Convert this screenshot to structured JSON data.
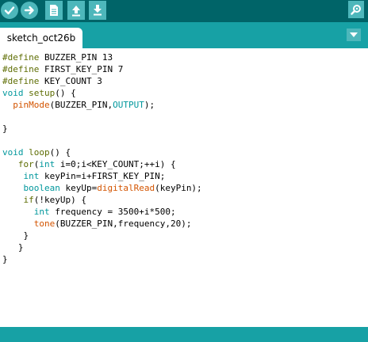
{
  "toolbar": {
    "buttons": [
      "verify-icon",
      "upload-icon",
      "new-icon",
      "open-icon",
      "save-icon"
    ],
    "serial_monitor": "serial-monitor-icon"
  },
  "tabs": [
    {
      "label": "sketch_oct26b",
      "active": true
    }
  ],
  "editor": {
    "lines": [
      [
        {
          "t": "#define",
          "c": "kw-pp"
        },
        {
          "t": " BUZZER_PIN 13"
        }
      ],
      [
        {
          "t": "#define",
          "c": "kw-pp"
        },
        {
          "t": " FIRST_KEY_PIN 7"
        }
      ],
      [
        {
          "t": "#define",
          "c": "kw-pp"
        },
        {
          "t": " KEY_COUNT 3"
        }
      ],
      [
        {
          "t": "void",
          "c": "kw-type"
        },
        {
          "t": " "
        },
        {
          "t": "setup",
          "c": "kw-ctrl"
        },
        {
          "t": "() {"
        }
      ],
      [
        {
          "t": "  "
        },
        {
          "t": "pinMode",
          "c": "kw-fn"
        },
        {
          "t": "(BUZZER_PIN,"
        },
        {
          "t": "OUTPUT",
          "c": "kw-type"
        },
        {
          "t": ");"
        }
      ],
      [],
      [
        {
          "t": "}"
        }
      ],
      [],
      [
        {
          "t": "void",
          "c": "kw-type"
        },
        {
          "t": " "
        },
        {
          "t": "loop",
          "c": "kw-ctrl"
        },
        {
          "t": "() {"
        }
      ],
      [
        {
          "t": "   "
        },
        {
          "t": "for",
          "c": "kw-ctrl"
        },
        {
          "t": "("
        },
        {
          "t": "int",
          "c": "kw-type"
        },
        {
          "t": " i=0;i<KEY_COUNT;++i) {"
        }
      ],
      [
        {
          "t": "    "
        },
        {
          "t": "int",
          "c": "kw-type"
        },
        {
          "t": " keyPin=i+FIRST_KEY_PIN;"
        }
      ],
      [
        {
          "t": "    "
        },
        {
          "t": "boolean",
          "c": "kw-type"
        },
        {
          "t": " keyUp="
        },
        {
          "t": "digitalRead",
          "c": "kw-fn"
        },
        {
          "t": "(keyPin);"
        }
      ],
      [
        {
          "t": "    "
        },
        {
          "t": "if",
          "c": "kw-ctrl"
        },
        {
          "t": "(!keyUp) {"
        }
      ],
      [
        {
          "t": "      "
        },
        {
          "t": "int",
          "c": "kw-type"
        },
        {
          "t": " frequency = 3500+i*500;"
        }
      ],
      [
        {
          "t": "      "
        },
        {
          "t": "tone",
          "c": "kw-fn"
        },
        {
          "t": "(BUZZER_PIN,frequency,20);"
        }
      ],
      [
        {
          "t": "    }"
        }
      ],
      [
        {
          "t": "   }"
        }
      ],
      [
        {
          "t": "}"
        }
      ]
    ]
  },
  "colors": {
    "toolbar": "#006468",
    "tabbar": "#17a1a5",
    "button": "#4db7bb",
    "preprocessor": "#5e6d03",
    "type": "#00979c",
    "function": "#d35400"
  }
}
